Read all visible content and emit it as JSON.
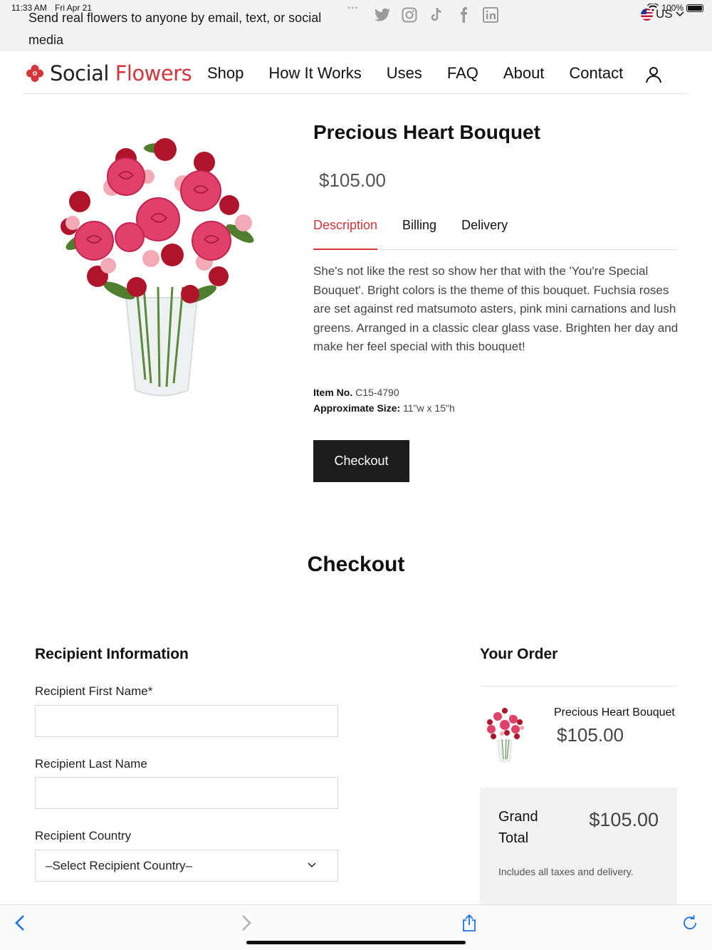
{
  "status": {
    "time": "11:33 AM",
    "date": "Fri Apr 21",
    "battery": "100%"
  },
  "promo": {
    "text": "Send real flowers to anyone by email, text, or social media"
  },
  "locale": {
    "label": "US"
  },
  "socials": [
    "twitter-icon",
    "instagram-icon",
    "tiktok-icon",
    "facebook-icon",
    "linkedin-icon"
  ],
  "brand": {
    "name_1": "Social",
    "name_2": "Flowers",
    "accent_color": "#d4343a"
  },
  "nav": {
    "shop": "Shop",
    "how": "How It Works",
    "uses": "Uses",
    "faq": "FAQ",
    "about": "About",
    "contact": "Contact"
  },
  "product": {
    "title": "Precious Heart Bouquet",
    "price": "$105.00",
    "tabs": {
      "description": "Description",
      "billing": "Billing",
      "delivery": "Delivery"
    },
    "description": "She's not like the rest so show her that with the 'You're Special Bouquet'. Bright colors is the theme of this bouquet. Fuchsia roses are set against red matsumoto asters, pink mini carnations and lush greens. Arranged in a classic clear glass vase. Brighten her day and make her feel special with this bouquet!",
    "item_no_label": "Item No.",
    "item_no": "C15-4790",
    "size_label": "Approximate Size:",
    "size": "11\"w x 15\"h",
    "checkout_button": "Checkout"
  },
  "checkout": {
    "heading": "Checkout",
    "recipient_title": "Recipient Information",
    "first_name_label": "Recipient First Name*",
    "last_name_label": "Recipient Last Name",
    "country_label": "Recipient Country",
    "country_select": "–Select Recipient Country–"
  },
  "order": {
    "title": "Your Order",
    "item_name": "Precious Heart Bouquet",
    "item_price": "$105.00",
    "grand_total_label": "Grand Total",
    "grand_total_value": "$105.00",
    "includes": "Includes all taxes and delivery."
  }
}
